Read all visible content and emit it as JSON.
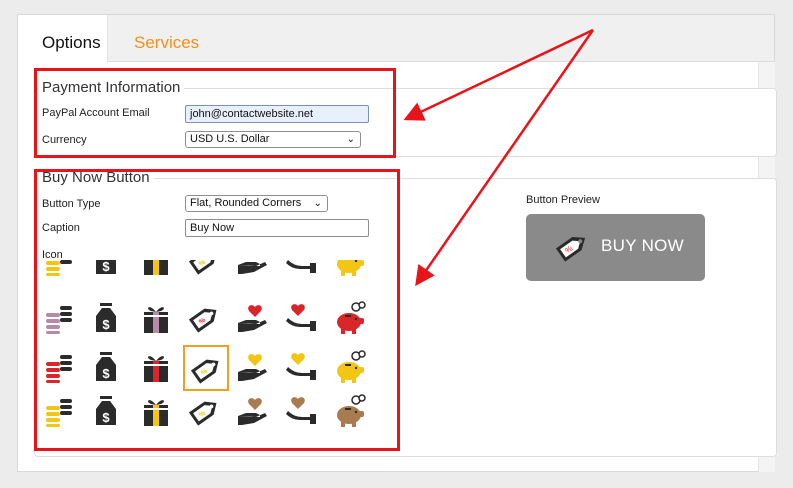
{
  "tabs": [
    {
      "label": "Options",
      "active": true
    },
    {
      "label": "Services",
      "active": false
    }
  ],
  "payment": {
    "legend": "Payment Information",
    "email_label": "PayPal Account Email",
    "email_value": "john@contactwebsite.net",
    "currency_label": "Currency",
    "currency_value": "USD U.S. Dollar"
  },
  "buy_now": {
    "legend": "Buy Now Button",
    "type_label": "Button Type",
    "type_value": "Flat, Rounded Corners",
    "caption_label": "Caption",
    "caption_value": "Buy Now",
    "icon_label": "Icon",
    "icon_columns": [
      "coins-icon",
      "money-bag-icon",
      "gift-icon",
      "discount-tag-icon",
      "heart-in-hand-icon",
      "heart-hand-icon",
      "piggy-bank-icon"
    ],
    "icon_rows": [
      {
        "color": "#b98aa8",
        "accent": "#a9708f"
      },
      {
        "color": "#d9262b",
        "accent": "#d9262b"
      },
      {
        "color": "#f3c515",
        "accent": "#f3c515"
      },
      {
        "color": "#a97b50",
        "accent": "#a97b50"
      }
    ],
    "partial_row_color": "#f3c515",
    "selected_icon": {
      "row": 2,
      "col": 3
    }
  },
  "preview": {
    "label": "Button Preview",
    "text": "BUY NOW",
    "bg": "#8a8a8a"
  },
  "colors": {
    "accent_tab": "#f0901c",
    "annotation_red": "#e8141b"
  }
}
